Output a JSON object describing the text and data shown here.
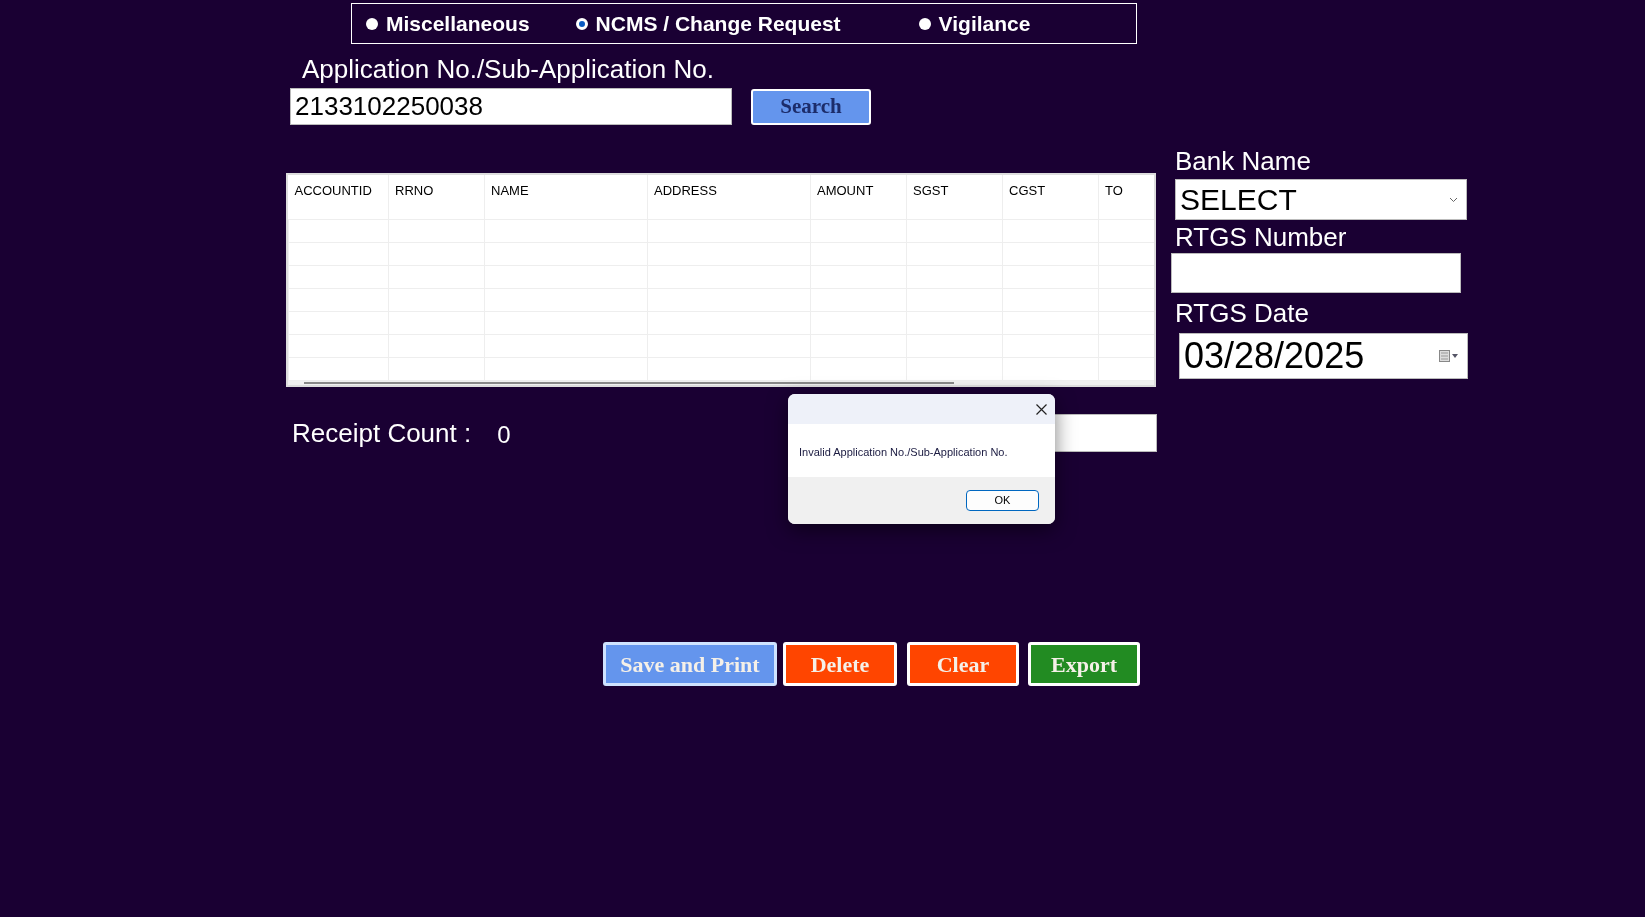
{
  "radio_options": [
    {
      "label": "Miscellaneous",
      "selected": false
    },
    {
      "label": "NCMS / Change Request",
      "selected": true
    },
    {
      "label": "Vigilance",
      "selected": false
    }
  ],
  "application": {
    "label": "Application No./Sub-Application No.",
    "value": "2133102250038",
    "search_button": "Search"
  },
  "grid": {
    "columns": [
      "ACCOUNTID",
      "RRNO",
      "NAME",
      "ADDRESS",
      "AMOUNT",
      "SGST",
      "CGST",
      "TO"
    ]
  },
  "receipt": {
    "label": "Receipt Count :",
    "value": "0"
  },
  "bank": {
    "label": "Bank Name",
    "value": "SELECT"
  },
  "rtgs_number": {
    "label": "RTGS Number"
  },
  "rtgs_date": {
    "label": "RTGS Date",
    "value": "03/28/2025"
  },
  "buttons": [
    {
      "label": "Save and Print",
      "kind": "primary"
    },
    {
      "label": "Delete",
      "kind": "danger"
    },
    {
      "label": "Clear",
      "kind": "danger"
    },
    {
      "label": "Export",
      "kind": "success"
    }
  ],
  "dialog": {
    "message": "Invalid Application No./Sub-Application No.",
    "ok_button": "OK"
  }
}
